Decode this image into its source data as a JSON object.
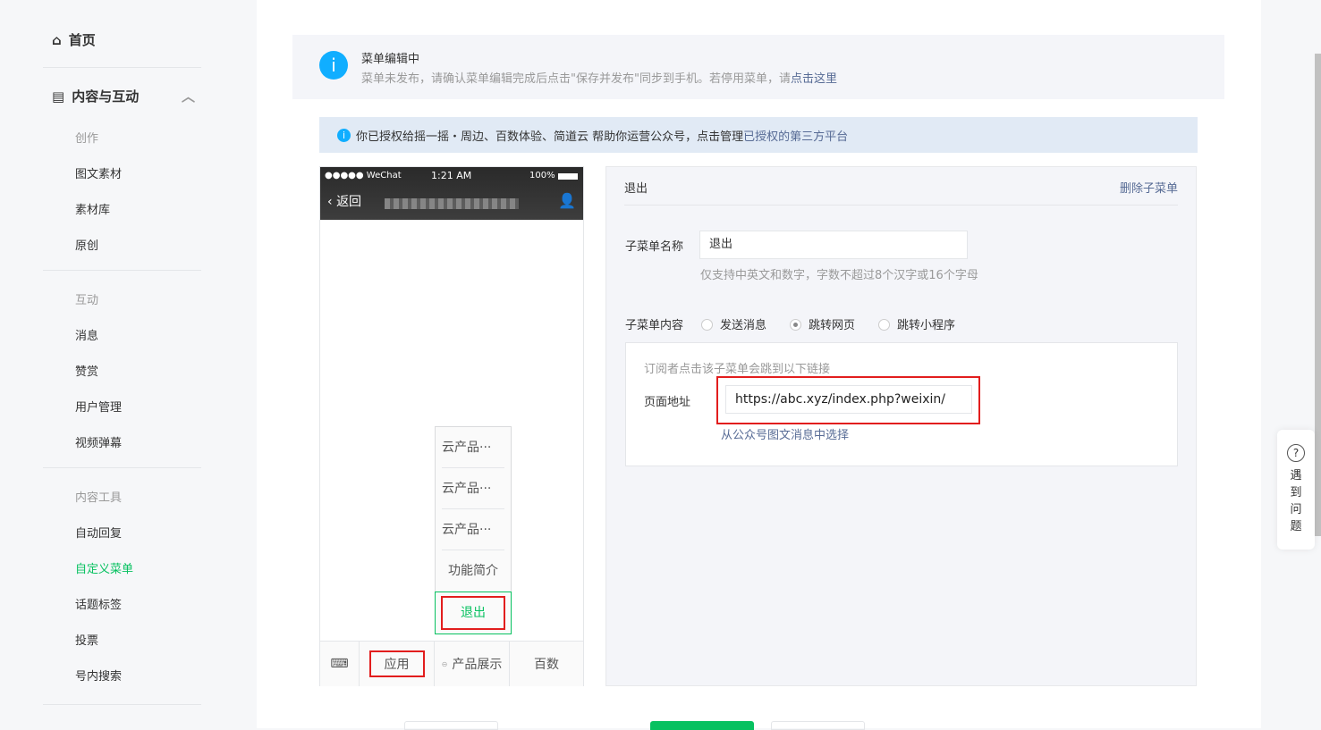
{
  "sidebar": {
    "home": "首页",
    "section": "内容与互动",
    "groups": [
      {
        "title": "创作",
        "items": [
          "图文素材",
          "素材库",
          "原创"
        ]
      },
      {
        "title": "互动",
        "items": [
          "消息",
          "赞赏",
          "用户管理",
          "视频弹幕"
        ]
      },
      {
        "title": "内容工具",
        "items": [
          "自动回复",
          "自定义菜单",
          "话题标签",
          "投票",
          "号内搜索"
        ]
      }
    ],
    "active": "自定义菜单"
  },
  "notice": {
    "title": "菜单编辑中",
    "text": "菜单未发布，请确认菜单编辑完成后点击\"保存并发布\"同步到手机。若停用菜单，请",
    "link": "点击这里"
  },
  "auth": {
    "text": "你已授权给摇一摇・周边、百数体验、简道云  帮助你运营公众号，点击管理",
    "link": "已授权的第三方平台"
  },
  "phone": {
    "carrier": "●●●●● WeChat",
    "time": "1:21 AM",
    "battery": "100%",
    "back": "返回",
    "submenu": [
      "云产品···",
      "云产品···",
      "云产品···",
      "功能简介",
      "退出"
    ],
    "menus": [
      "应用",
      "产品展示",
      "百数"
    ]
  },
  "editor": {
    "title": "退出",
    "delete": "删除子菜单",
    "name_label": "子菜单名称",
    "name_value": "退出",
    "name_hint": "仅支持中英文和数字，字数不超过8个汉字或16个字母",
    "content_label": "子菜单内容",
    "options": [
      "发送消息",
      "跳转网页",
      "跳转小程序"
    ],
    "selected": "跳转网页",
    "box_hint": "订阅者点击该子菜单会跳到以下链接",
    "url_label": "页面地址",
    "url_value": "https://abc.xyz/index.php?weixin/",
    "pick_link": "从公众号图文消息中选择"
  },
  "help": [
    "遇",
    "到",
    "问",
    "题"
  ],
  "colors": {
    "accent": "#07c160",
    "link": "#576b95",
    "info": "#10aeff",
    "highlight": "#e21d1d"
  }
}
